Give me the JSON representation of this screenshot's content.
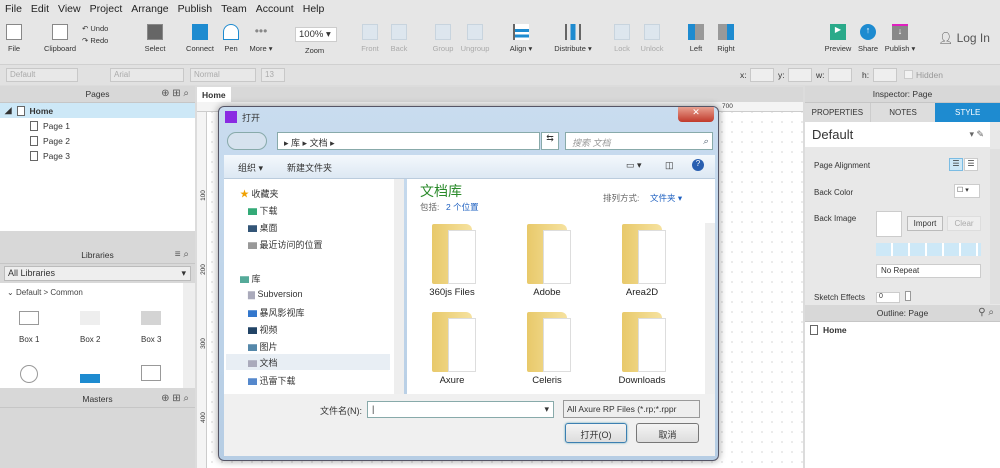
{
  "menu": [
    "File",
    "Edit",
    "View",
    "Project",
    "Arrange",
    "Publish",
    "Team",
    "Account",
    "Help"
  ],
  "toolbar": {
    "file": "File",
    "clipboard": "Clipboard",
    "undo": "Undo",
    "redo": "Redo",
    "select": "Select",
    "connect": "Connect",
    "pen": "Pen",
    "more": "More ▾",
    "zoom_value": "100%",
    "zoom": "Zoom",
    "front": "Front",
    "back": "Back",
    "group": "Group",
    "ungroup": "Ungroup",
    "align": "Align ▾",
    "distribute": "Distribute ▾",
    "lock": "Lock",
    "unlock": "Unlock",
    "left": "Left",
    "right": "Right",
    "preview": "Preview",
    "share": "Share",
    "publish": "Publish ▾",
    "login": "Log In"
  },
  "format": {
    "style": "Default",
    "font": "Arial",
    "weight": "Normal",
    "size": "13",
    "x": "x:",
    "y": "y:",
    "w": "w:",
    "h": "h:",
    "hidden": "Hidden"
  },
  "pages": {
    "title": "Pages",
    "items": [
      "Home",
      "Page 1",
      "Page 2",
      "Page 3"
    ]
  },
  "libraries": {
    "title": "Libraries",
    "select": "All Libraries",
    "group": "Default > Common",
    "items": [
      "Box 1",
      "Box 2",
      "Box 3"
    ]
  },
  "masters": {
    "title": "Masters"
  },
  "canvas": {
    "tab": "Home",
    "ruler_top": "700",
    "ruler_left": [
      "100",
      "200",
      "300",
      "400"
    ]
  },
  "inspector": {
    "title": "Inspector: Page",
    "tabs": [
      "PROPERTIES",
      "NOTES",
      "STYLE"
    ],
    "style": "Default",
    "page_alignment": "Page Alignment",
    "back_color": "Back Color",
    "back_image": "Back Image",
    "import": "Import",
    "clear": "Clear",
    "repeat": "No Repeat",
    "sketch": "Sketch Effects",
    "sketch_value": "0"
  },
  "outline": {
    "title": "Outline: Page",
    "item": "Home"
  },
  "dialog": {
    "title": "打开",
    "path": [
      "库",
      "文档"
    ],
    "search": "搜索 文档",
    "organize": "组织 ▾",
    "new_folder": "新建文件夹",
    "nav": {
      "favorites": "收藏夹",
      "fav_items": [
        "下载",
        "桌面",
        "最近访问的位置"
      ],
      "library": "库",
      "lib_items": [
        "Subversion",
        "暴风影视库",
        "视频",
        "图片",
        "文档",
        "迅雷下载"
      ]
    },
    "lib_title": "文档库",
    "includes": "包括:",
    "locations": "2 个位置",
    "sort_label": "排列方式:",
    "sort_value": "文件夹 ▾",
    "folders": [
      "360js Files",
      "Adobe",
      "Area2D",
      "Axure",
      "Celeris",
      "Downloads"
    ],
    "filename_label": "文件名(N):",
    "filename": "",
    "filetype": "All Axure RP Files (*.rp;*.rppr",
    "open": "打开(O)",
    "cancel": "取消"
  }
}
